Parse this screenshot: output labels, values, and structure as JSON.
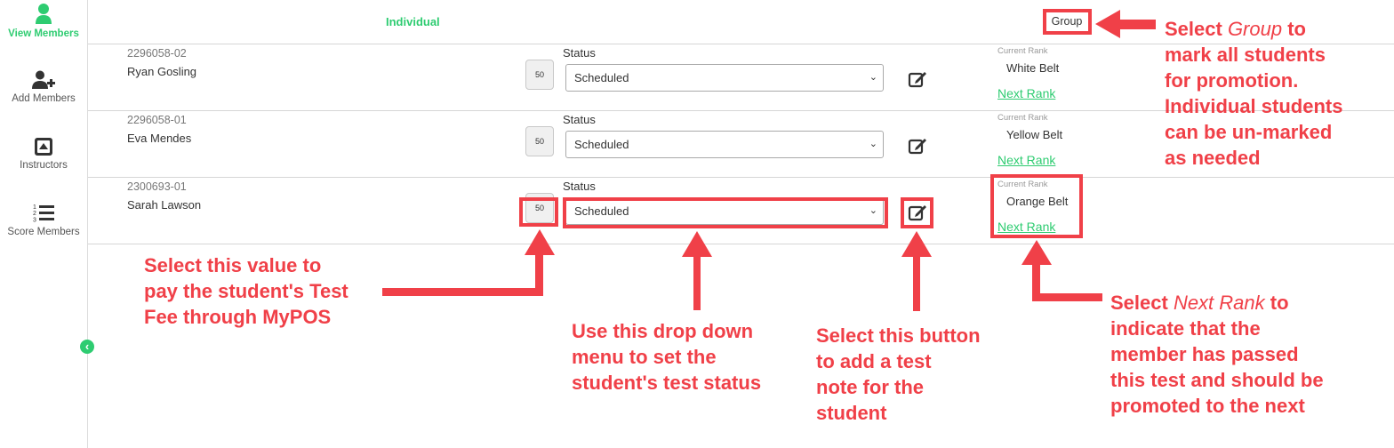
{
  "sidebar": {
    "items": [
      {
        "label": "View Members",
        "icon": "user-icon",
        "active": true
      },
      {
        "label": "Add Members",
        "icon": "user-plus-icon",
        "active": false
      },
      {
        "label": "Instructors",
        "icon": "eject-icon",
        "active": false
      },
      {
        "label": "Score Members",
        "icon": "numbered-list-icon",
        "active": false
      }
    ],
    "collapse_glyph": "‹"
  },
  "header": {
    "individual_tab": "Individual",
    "group_button": "Group"
  },
  "members": [
    {
      "id": "2296058-02",
      "name": "Ryan Gosling",
      "fee": "50",
      "status_label": "Status",
      "status": "Scheduled",
      "rank_label": "Current Rank",
      "current_rank": "White Belt",
      "next_rank": "Next Rank"
    },
    {
      "id": "2296058-01",
      "name": "Eva Mendes",
      "fee": "50",
      "status_label": "Status",
      "status": "Scheduled",
      "rank_label": "Current Rank",
      "current_rank": "Yellow Belt",
      "next_rank": "Next Rank"
    },
    {
      "id": "2300693-01",
      "name": "Sarah Lawson",
      "fee": "50",
      "status_label": "Status",
      "status": "Scheduled",
      "rank_label": "Current Rank",
      "current_rank": "Orange Belt",
      "next_rank": "Next Rank"
    }
  ],
  "annotations": {
    "group_pre": "Select ",
    "group_em": "Group",
    "group_post": " to\nmark all students\nfor promotion.\nIndividual students\ncan be un-marked\nas needed",
    "fee": "Select this value to\npay the student's Test\nFee through MyPOS",
    "status": "Use this drop down\nmenu to set the\nstudent's test status",
    "note": "Select this button\nto add a  test\nnote for the\nstudent",
    "rank_pre": "Select ",
    "rank_em": "Next Rank",
    "rank_post": " to\nindicate that the\nmember has passed\nthis test and should be\npromoted to the next"
  },
  "colors": {
    "accent": "#2ecc71",
    "annotation": "#f04048",
    "divider": "#d6d6d6"
  }
}
